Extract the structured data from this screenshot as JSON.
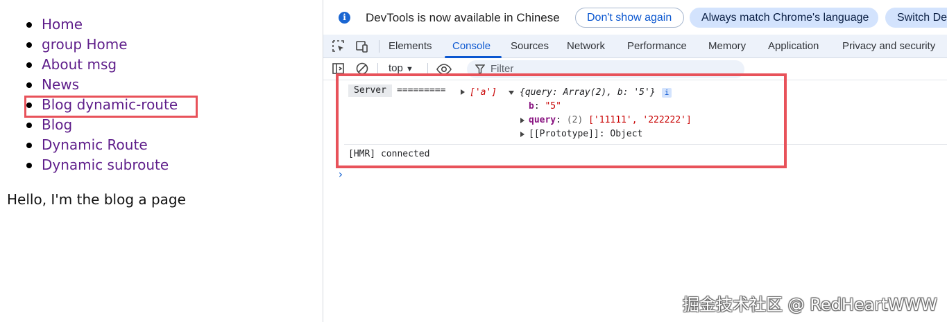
{
  "page": {
    "nav_items": [
      "Home",
      "group Home",
      "About msg",
      "News",
      "Blog dynamic-route",
      "Blog",
      "Dynamic Route",
      "Dynamic subroute"
    ],
    "content_text": "Hello, I'm the blog a page"
  },
  "devtools": {
    "infobar": {
      "message": "DevTools is now available in Chinese",
      "dont_show_label": "Don't show again",
      "always_match_label": "Always match Chrome's language",
      "switch_label": "Switch Dev"
    },
    "tabs": [
      "Elements",
      "Console",
      "Sources",
      "Network",
      "Performance",
      "Memory",
      "Application",
      "Privacy and security"
    ],
    "active_tab": "Console",
    "console_toolbar": {
      "context": "top",
      "filter_placeholder": "Filter"
    },
    "console": {
      "badge": "Server",
      "separator": "=========",
      "array_preview": "['a']",
      "object_preview": "{query: Array(2), b: '5'}",
      "info_icon": "i",
      "prop_b_key": "b",
      "prop_b_value": "\"5\"",
      "prop_query_key": "query",
      "prop_query_count": "(2)",
      "prop_query_value": "['11111', '222222']",
      "prop_proto": "[[Prototype]]: Object",
      "hmr_message": "[HMR] connected"
    }
  },
  "watermark": "掘金技术社区 @ RedHeartWWW",
  "colors": {
    "link": "#5e1d8a",
    "highlight": "#e8525a",
    "accent": "#0b57d0"
  }
}
